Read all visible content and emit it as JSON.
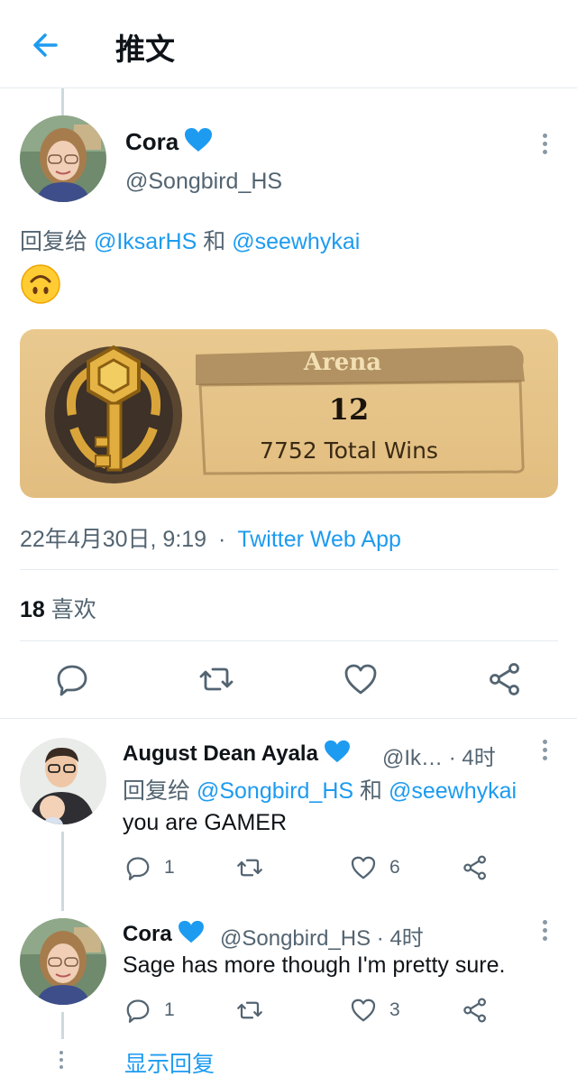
{
  "header": {
    "title": "推文"
  },
  "tweet": {
    "name": "Cora",
    "handle": "@Songbird_HS",
    "reply_prefix": "回复给",
    "reply_to_1": "@IksarHS",
    "reply_joiner": "和",
    "reply_to_2": "@seewhykai",
    "emoji": "upside-down-face",
    "card": {
      "label": "Arena",
      "number": "12",
      "wins": "7752 Total Wins"
    },
    "timestamp": "22年4月30日, 9:19",
    "dot": "·",
    "source": "Twitter Web App",
    "likes_count": "18",
    "likes_label": "喜欢"
  },
  "replies": [
    {
      "name": "August Dean Ayala",
      "meta": "@Ik…  · 4时",
      "reply_prefix": "回复给",
      "reply_to_1": "@Songbird_HS",
      "reply_joiner": "和",
      "reply_to_2": "@seewhykai",
      "text": "you are GAMER",
      "reply_count": "1",
      "like_count": "6"
    },
    {
      "name": "Cora",
      "meta": "@Songbird_HS · 4时",
      "text": "Sage has more though I'm pretty sure.",
      "reply_count": "1",
      "like_count": "3"
    }
  ],
  "show_replies": "显示回复",
  "colors": {
    "accent": "#1d9bf0",
    "verified": "#1d9bf0",
    "muted": "#536471",
    "divider": "#e6ecf0"
  },
  "icons": [
    "back-arrow-icon",
    "more-icon",
    "reply-icon",
    "retweet-icon",
    "like-icon",
    "share-icon"
  ]
}
